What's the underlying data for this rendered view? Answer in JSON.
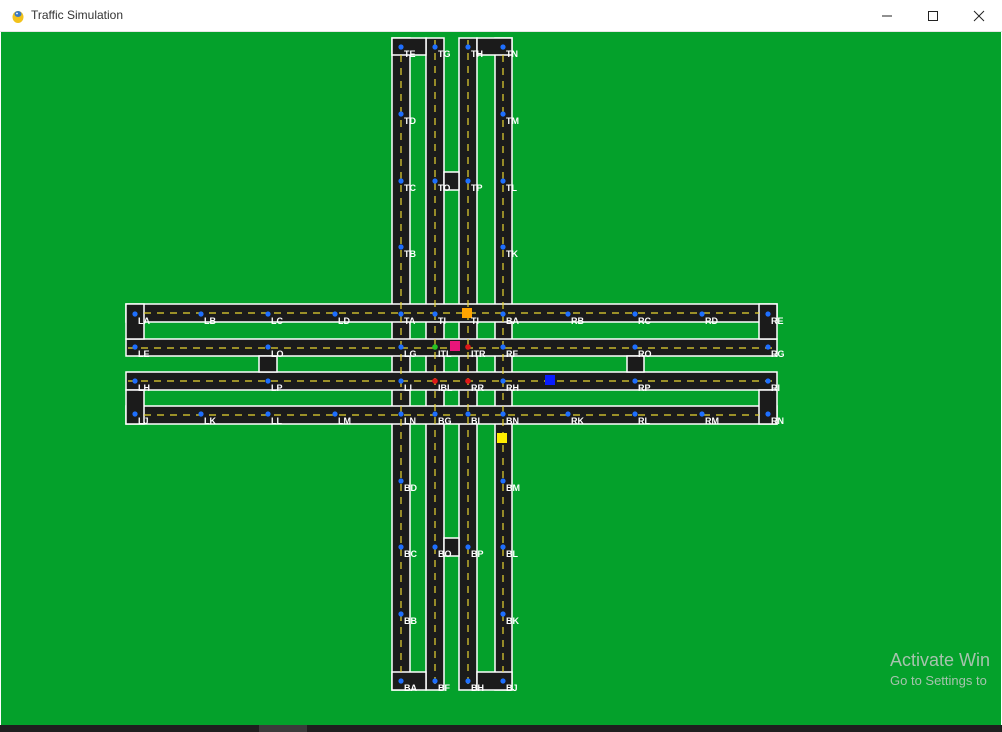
{
  "window": {
    "title": "Traffic Simulation",
    "icon": "pygame-snake-icon",
    "controls": [
      "minimize-icon",
      "maximize-icon",
      "close-icon"
    ]
  },
  "colors": {
    "grass": "#04a12b",
    "road": "#1b1b1b",
    "road_edge": "#ffffff",
    "lane_divider": "#e8d531",
    "node": "#1e6fff",
    "signal_green": "#24c224",
    "signal_red": "#e01818"
  },
  "node_labels": {
    "top_left": [
      "TE",
      "TD",
      "TC",
      "TB",
      "TA"
    ],
    "top_center_left": [
      "TG",
      "TO",
      "TI",
      "ITL"
    ],
    "top_center_right": [
      "TH",
      "TP",
      "TI",
      "ITR"
    ],
    "top_right": [
      "TN",
      "TM",
      "TL",
      "TK",
      "BA"
    ],
    "left_upper": [
      "LA",
      "LB",
      "LC",
      "LD"
    ],
    "left_lower_mid": [
      "LE",
      "LO",
      "LG"
    ],
    "left_upper_mid": [
      "LH",
      "LP",
      "LI",
      "IBL"
    ],
    "left_bottom": [
      "LJ",
      "LK",
      "LL",
      "LM",
      "LN"
    ],
    "right_upper": [
      "RB",
      "RC",
      "RD",
      "RE"
    ],
    "right_upper_mid": [
      "RF",
      "RO",
      "RG",
      "ITR"
    ],
    "right_lower_mid": [
      "RR",
      "RH",
      "RP",
      "RI",
      "IBR"
    ],
    "right_bottom": [
      "BN",
      "RK",
      "RL",
      "RM",
      "RN"
    ],
    "bottom_left": [
      "BG",
      "BD",
      "BC",
      "BB",
      "BA"
    ],
    "bottom_center_left": [
      "BO",
      "BF"
    ],
    "bottom_center_right": [
      "BI",
      "BP",
      "BH"
    ],
    "bottom_right": [
      "BM",
      "BL",
      "BK",
      "BJ"
    ]
  },
  "vehicles": [
    {
      "name": "vehicle-orange",
      "color": "#ffa500"
    },
    {
      "name": "vehicle-magenta",
      "color": "#e8157a"
    },
    {
      "name": "vehicle-blue",
      "color": "#0a1cff"
    },
    {
      "name": "vehicle-yellow",
      "color": "#ffee00"
    }
  ],
  "watermark": {
    "line1": "Activate Win",
    "line2": "Go to Settings to"
  }
}
